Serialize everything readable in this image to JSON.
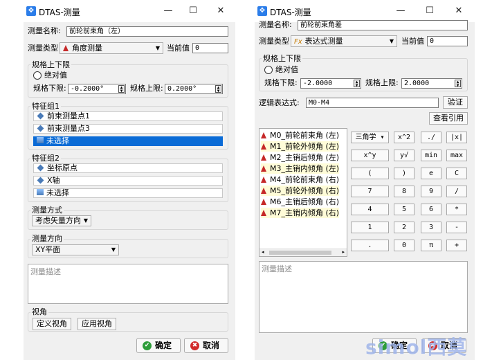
{
  "dialog1": {
    "title": "DTAS-测量",
    "name_label": "测量名称:",
    "name_value": "前轮前束角（左）",
    "type_label": "测量类型",
    "type_value": "角度测量",
    "current_label": "当前值",
    "current_value": "0",
    "limits_group": "规格上下限",
    "abs_label": "绝对值",
    "lower_label": "规格下限:",
    "lower_value": "-0.2000°",
    "upper_label": "规格上限:",
    "upper_value": "0.2000°",
    "feature1_group": "特征组1",
    "feature1_items": [
      "前束测量点1",
      "前束测量点3",
      "未选择"
    ],
    "feature2_group": "特征组2",
    "feature2_items": [
      "坐标原点",
      "X轴",
      "未选择"
    ],
    "method_group": "测量方式",
    "method_value": "考虑矢量方向",
    "direction_group": "测量方向",
    "direction_value": "XY平面",
    "desc_placeholder": "测量描述",
    "view_group": "视角",
    "define_view": "定义视角",
    "apply_view": "应用视角",
    "ok": "确定",
    "cancel": "取消"
  },
  "dialog2": {
    "title": "DTAS-测量",
    "name_label": "测量名称:",
    "name_value": "前轮前束角差",
    "type_label": "测量类型",
    "type_icon_text": "Fx",
    "type_value": "表达式测量",
    "current_label": "当前值",
    "current_value": "0",
    "limits_group": "规格上下限",
    "abs_label": "绝对值",
    "lower_label": "规格下限:",
    "lower_value": "-2.0000",
    "upper_label": "规格上限:",
    "upper_value": "2.0000",
    "expr_label": "逻辑表达式:",
    "expr_value": "M0-M4",
    "verify": "验证",
    "view_refs": "查看引用",
    "measurements": [
      "M0_前轮前束角 (左)",
      "M1_前轮外倾角 (左)",
      "M2_主销后倾角 (左)",
      "M3_主销内倾角 (左)",
      "M4_前轮前束角 (右)",
      "M5_前轮外倾角 (右)",
      "M6_主销后倾角 (右)",
      "M7_主销内倾角 (右)"
    ],
    "keypad": [
      [
        "三角学 ▾",
        "x^2",
        "./",
        "|x|"
      ],
      [
        "x^y",
        "y√",
        "min",
        "max"
      ],
      [
        "(",
        ")",
        "e",
        "C"
      ],
      [
        "7",
        "8",
        "9",
        "/"
      ],
      [
        "4",
        "5",
        "6",
        "*"
      ],
      [
        "1",
        "2",
        "3",
        "-"
      ],
      [
        ".",
        "0",
        "π",
        "+"
      ]
    ],
    "desc_placeholder": "测量描述",
    "ok": "确定",
    "cancel": "取消"
  },
  "watermark": "simol西莫"
}
